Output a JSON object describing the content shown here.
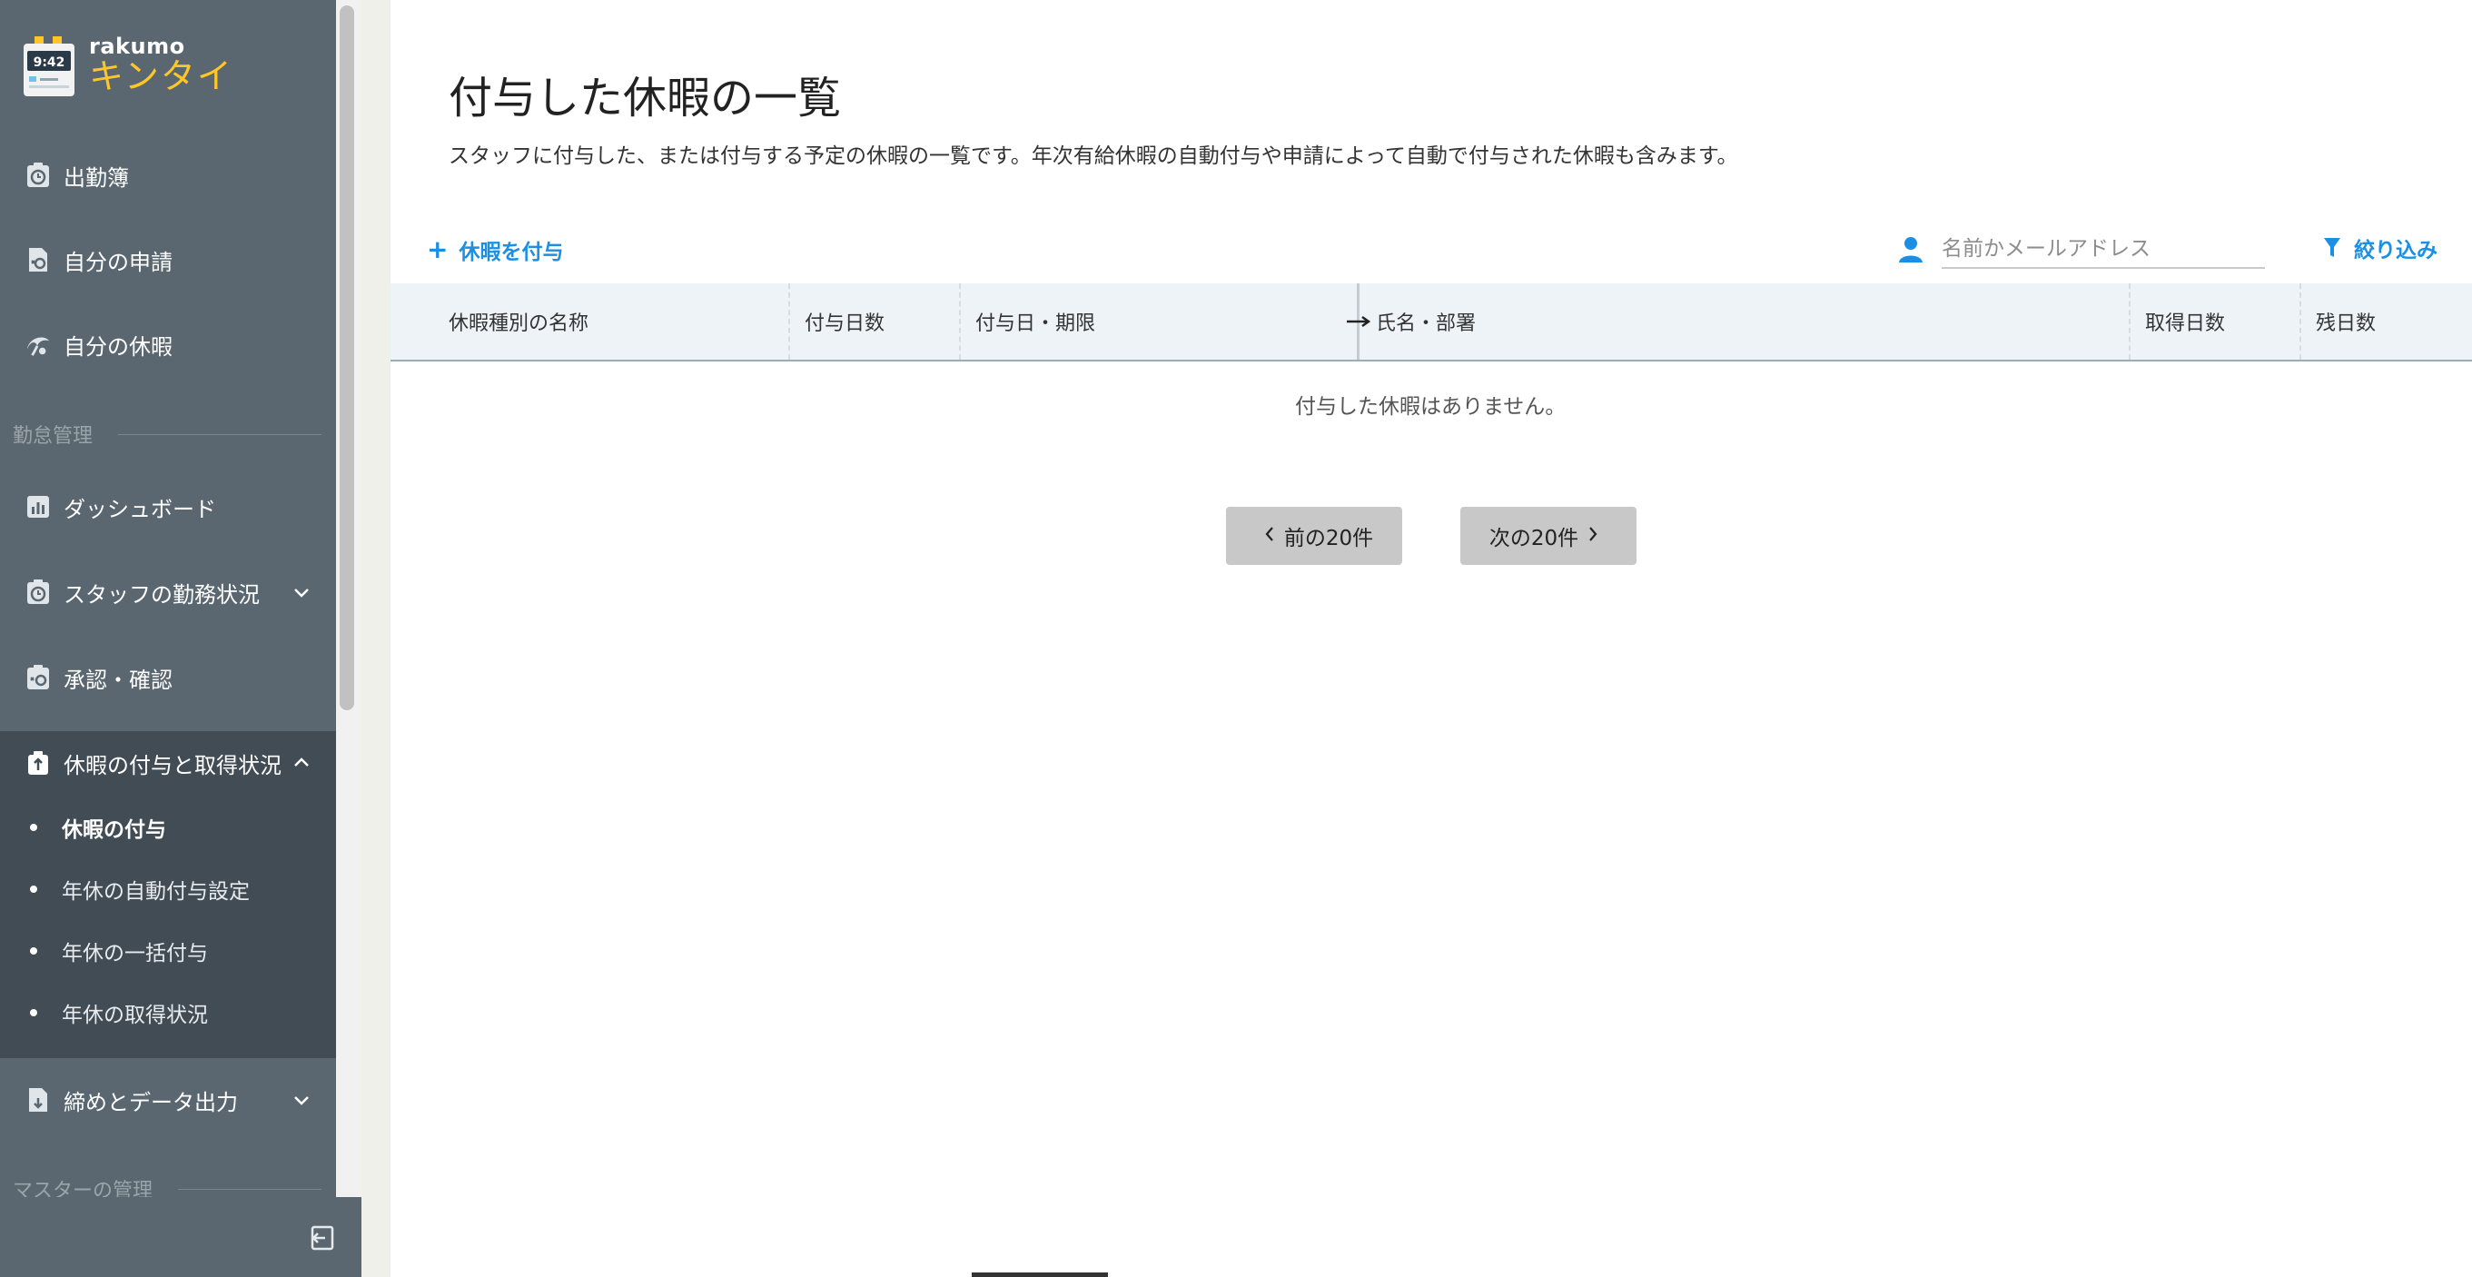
{
  "app": {
    "brand_small": "rakumo",
    "brand_large": "キンタイ",
    "clock_text": "9:42"
  },
  "sidebar": {
    "items": [
      {
        "label": "出勤簿",
        "icon": "clock-badge-icon"
      },
      {
        "label": "自分の申請",
        "icon": "document-request-icon"
      },
      {
        "label": "自分の休暇",
        "icon": "palm-leaf-icon"
      }
    ],
    "section_attendance": "勤怠管理",
    "management_items": [
      {
        "label": "ダッシュボード",
        "icon": "chart-icon"
      },
      {
        "label": "スタッフの勤務状況",
        "icon": "clock-badge-icon",
        "expandable": true
      },
      {
        "label": "承認・確認",
        "icon": "approval-icon"
      }
    ],
    "leave_group": {
      "label": "休暇の付与と取得状況",
      "icon": "gift-clip-icon",
      "expanded": true,
      "sub_items": [
        {
          "label": "休暇の付与",
          "active": true
        },
        {
          "label": "年休の自動付与設定",
          "active": false
        },
        {
          "label": "年休の一括付与",
          "active": false
        },
        {
          "label": "年休の取得状況",
          "active": false
        }
      ]
    },
    "closing_item": {
      "label": "締めとデータ出力",
      "icon": "export-document-icon",
      "expandable": true
    },
    "section_master": "マスターの管理"
  },
  "main": {
    "title": "付与した休暇の一覧",
    "description": "スタッフに付与した、または付与する予定の休暇の一覧です。年次有給休暇の自動付与や申請によって自動で付与された休暇も含みます。",
    "add_label": "休暇を付与",
    "search_placeholder": "名前かメールアドレス",
    "filter_label": "絞り込み",
    "table": {
      "columns": [
        "休暇種別の名称",
        "付与日数",
        "付与日・期限",
        "氏名・部署",
        "取得日数",
        "残日数"
      ],
      "empty_message": "付与した休暇はありません。"
    },
    "pagination": {
      "prev_label": "前の20件",
      "next_label": "次の20件"
    }
  },
  "colors": {
    "sidebar_bg": "#5a6770",
    "sidebar_expanded_bg": "#424c55",
    "accent_blue": "#1a8fe3",
    "brand_yellow": "#ffc629",
    "table_header_bg": "#eef3f7"
  }
}
